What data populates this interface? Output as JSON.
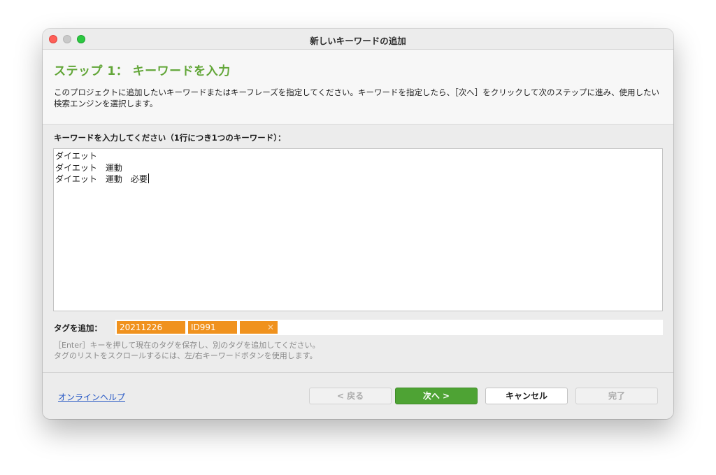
{
  "window": {
    "title": "新しいキーワードの追加"
  },
  "header": {
    "step_title": "ステップ 1： キーワードを入力",
    "description": "このプロジェクトに追加したいキーワードまたはキーフレーズを指定してください。キーワードを指定したら、［次へ］をクリックして次のステップに進み、使用したい検索エンジンを選択します。"
  },
  "keywords": {
    "label": "キーワードを入力してください（1行につき1つのキーワード）：",
    "lines": [
      "ダイエット",
      "ダイエット　運動",
      "ダイエット　運動　必要"
    ]
  },
  "tags": {
    "label": "タグを追加：",
    "items": [
      "20211226",
      "ID991"
    ],
    "new_tag_value": "",
    "remove_symbol": "✕",
    "hint_line1": "［Enter］キーを押して現在のタグを保存し、別のタグを追加してください。",
    "hint_line2": "タグのリストをスクロールするには、左/右キーワードボタンを使用します。"
  },
  "footer": {
    "help_link": "オンラインヘルプ",
    "back_label": "< 戻る",
    "next_label": "次へ >",
    "cancel_label": "キャンセル",
    "finish_label": "完了"
  },
  "colors": {
    "step_title": "#62a638",
    "next_button": "#4ea334",
    "tag": "#f0921e",
    "link": "#2456c4"
  }
}
